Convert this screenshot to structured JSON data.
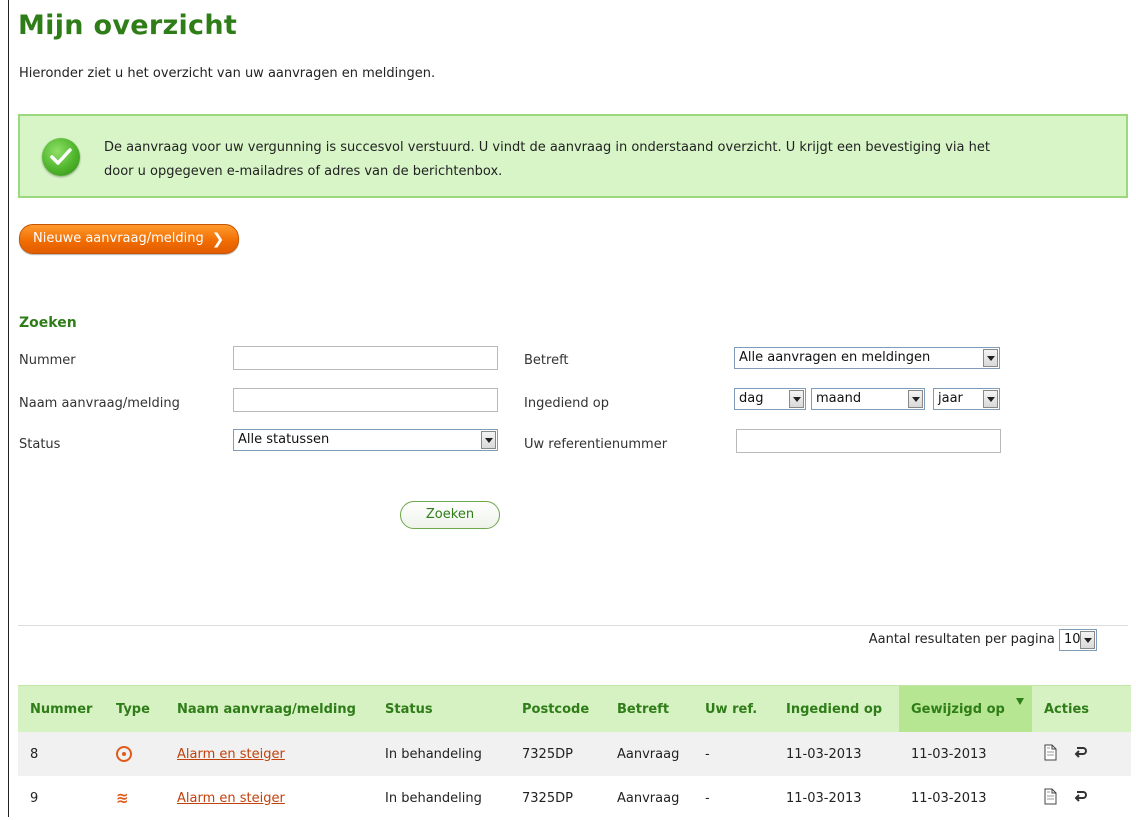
{
  "page": {
    "title": "Mijn overzicht",
    "intro": "Hieronder ziet u het overzicht van uw aanvragen en meldingen."
  },
  "success": {
    "icon": "checkmark-icon",
    "line1": "De aanvraag voor uw vergunning is succesvol verstuurd. U vindt de aanvraag in onderstaand overzicht. U krijgt een bevestiging via het",
    "line2": "door u opgegeven e-mailadres of adres van de berichtenbox."
  },
  "new_button": {
    "label": "Nieuwe aanvraag/melding",
    "chevron": "❯"
  },
  "search": {
    "title": "Zoeken",
    "labels": {
      "nummer": "Nummer",
      "naam": "Naam aanvraag/melding",
      "status": "Status",
      "betreft": "Betreft",
      "ingediend": "Ingediend op",
      "referentie": "Uw referentienummer"
    },
    "values": {
      "nummer": "",
      "naam": "",
      "status": "Alle statussen",
      "betreft": "Alle aanvragen en meldingen",
      "dag": "dag",
      "maand": "maand",
      "jaar": "jaar",
      "referentie": ""
    },
    "button": "Zoeken"
  },
  "results": {
    "per_page_label": "Aantal resultaten per pagina",
    "per_page_value": "10",
    "columns": [
      "Nummer",
      "Type",
      "Naam aanvraag/melding",
      "Status",
      "Postcode",
      "Betreft",
      "Uw ref.",
      "Ingediend op",
      "Gewijzigd op",
      "Acties"
    ],
    "rows": [
      {
        "nummer": "8",
        "type_icon": "target-icon",
        "naam": "Alarm en steiger",
        "status": "In behandeling",
        "postcode": "7325DP",
        "betreft": "Aanvraag",
        "ref": "-",
        "ingediend": "11-03-2013",
        "gewijzigd": "11-03-2013"
      },
      {
        "nummer": "9",
        "type_icon": "wave-icon",
        "naam": "Alarm en steiger",
        "status": "In behandeling",
        "postcode": "7325DP",
        "betreft": "Aanvraag",
        "ref": "-",
        "ingediend": "11-03-2013",
        "gewijzigd": "11-03-2013"
      }
    ]
  },
  "colors": {
    "title_green": "#2f7d18",
    "accent_orange": "#f06b00",
    "success_bg": "#d8f5c8",
    "link": "#c2410c"
  }
}
